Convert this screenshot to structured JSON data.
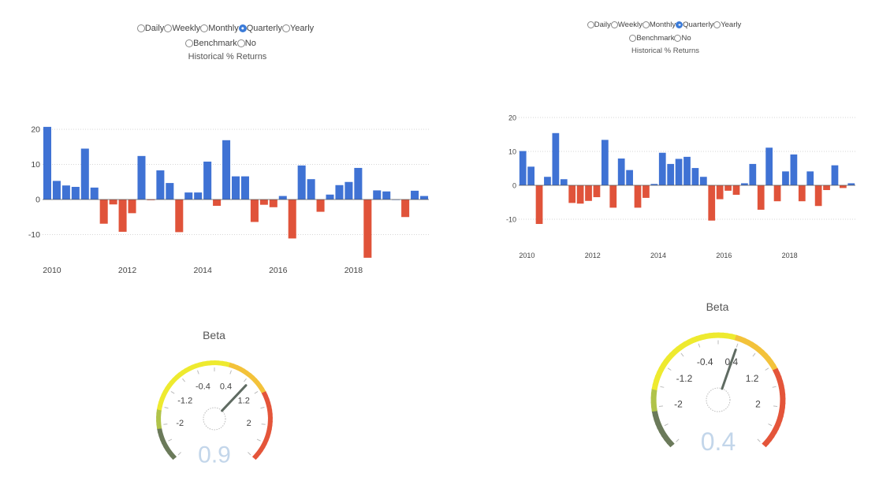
{
  "left": {
    "period_options": [
      {
        "label": "Daily",
        "checked": false
      },
      {
        "label": "Weekly",
        "checked": false
      },
      {
        "label": "Monthly",
        "checked": false
      },
      {
        "label": "Quarterly",
        "checked": true
      },
      {
        "label": "Yearly",
        "checked": false
      }
    ],
    "benchmark_options": [
      {
        "label": "Benchmark",
        "checked": false
      },
      {
        "label": "No",
        "checked": false
      }
    ],
    "chart_title": "Historical % Returns",
    "gauge_title": "Beta",
    "gauge_value": "0.9"
  },
  "right": {
    "period_options": [
      {
        "label": "Daily",
        "checked": false
      },
      {
        "label": "Weekly",
        "checked": false
      },
      {
        "label": "Monthly",
        "checked": false
      },
      {
        "label": "Quarterly",
        "checked": true
      },
      {
        "label": "Yearly",
        "checked": false
      }
    ],
    "benchmark_options": [
      {
        "label": "Benchmark",
        "checked": false
      },
      {
        "label": "No",
        "checked": false
      }
    ],
    "chart_title": "Historical % Returns",
    "gauge_title": "Beta",
    "gauge_value": "0.4"
  },
  "colors": {
    "positive": "#3f72d4",
    "negative": "#e0533a",
    "gauge_value": "#c3d6ea",
    "needle": "#5f6b62",
    "grid": "#d6d6d6"
  },
  "chart_data": [
    {
      "type": "bar",
      "title": "Historical % Returns",
      "ylim": [
        -17,
        22
      ],
      "yticks": [
        -10,
        0,
        10,
        20
      ],
      "xticks": [
        2010,
        2012,
        2014,
        2016,
        2018
      ],
      "x_start_year": 2009.75,
      "period": "quarterly",
      "values": [
        20.7,
        5.3,
        4.0,
        3.6,
        14.5,
        3.4,
        -6.9,
        -1.4,
        -9.2,
        -3.9,
        12.4,
        -0.2,
        8.3,
        4.7,
        -9.3,
        2.0,
        2.0,
        10.8,
        -1.8,
        16.9,
        6.6,
        6.6,
        -6.4,
        -1.5,
        -2.2,
        1.0,
        -11.1,
        9.7,
        5.8,
        -3.5,
        1.4,
        4.1,
        5.0,
        9.0,
        -16.6,
        2.6,
        2.3,
        0.0,
        -5.0,
        2.5,
        1.0
      ],
      "grid": true
    },
    {
      "type": "bar",
      "title": "Historical % Returns",
      "ylim": [
        -12,
        22
      ],
      "yticks": [
        -10,
        0,
        10,
        20
      ],
      "xticks": [
        2010,
        2012,
        2014,
        2016,
        2018
      ],
      "x_start_year": 2009.75,
      "period": "quarterly",
      "values": [
        10.1,
        5.5,
        -11.4,
        2.5,
        15.4,
        1.8,
        -5.2,
        -5.4,
        -4.6,
        -3.5,
        13.4,
        -6.6,
        7.9,
        4.5,
        -6.6,
        -3.7,
        0.4,
        9.6,
        6.3,
        7.8,
        8.4,
        5.1,
        2.5,
        -10.4,
        -4.1,
        -1.6,
        -2.8,
        0.6,
        6.3,
        -7.2,
        11.1,
        -4.7,
        4.1,
        9.1,
        -4.7,
        4.1,
        -6.1,
        -1.4,
        5.9,
        -0.8,
        0.6
      ],
      "grid": true
    }
  ],
  "gauges": [
    {
      "title": "Beta",
      "value": 0.9,
      "tick_labels": [
        "-2",
        "-1.2",
        "-0.4",
        "0.4",
        "1.2",
        "2"
      ],
      "range": [
        -2.8,
        2.8
      ]
    },
    {
      "title": "Beta",
      "value": 0.4,
      "tick_labels": [
        "-2",
        "-1.2",
        "-0.4",
        "0.4",
        "1.2",
        "2"
      ],
      "range": [
        -2.8,
        2.8
      ]
    }
  ]
}
